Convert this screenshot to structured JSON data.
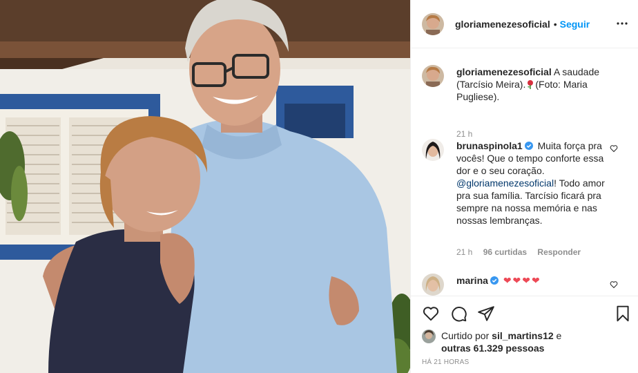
{
  "post": {
    "username": "gloriamenezesoficial",
    "follow_label": "Seguir",
    "separator": "•"
  },
  "caption": {
    "username": "gloriamenezesoficial",
    "text_1": "A saudade",
    "text_2": "(Tarcísio Meira).",
    "text_3": "(Foto: Maria",
    "text_4": "Pugliese).",
    "time": "21 h"
  },
  "comments": [
    {
      "username": "brunaspinola1",
      "verified": true,
      "line_1": "Muita força pra",
      "line_2": "vocês! Que o tempo conforte essa",
      "line_3": "dor e o seu coração.",
      "mention": "@gloriamenezesoficial",
      "line_4_rest": "! Todo",
      "line_5": "amor pra sua família. Tarcísio",
      "line_6": "ficará pra sempre na nossa",
      "line_7": "memória e nas nossas",
      "line_8": "lembranças.",
      "time": "21 h",
      "likes": "96 curtidas",
      "reply_label": "Responder"
    },
    {
      "username": "marina",
      "verified": true,
      "hearts": "❤❤❤❤"
    }
  ],
  "likes": {
    "prefix": "Curtido por",
    "user": "sil_martins12",
    "connector": "e",
    "others": "outras 61.329 pessoas"
  },
  "timestamp": "HÁ 21 HORAS",
  "colors": {
    "accent": "#0095f6",
    "text": "#262626",
    "muted": "#8e8e8e",
    "border": "#efefef",
    "mention": "#00376b",
    "heart_red": "#ed4956"
  },
  "icons": {
    "more": "more-horizontal-icon",
    "like": "heart-outline-icon",
    "comment": "comment-bubble-icon",
    "share": "paper-plane-icon",
    "save": "bookmark-icon",
    "verified": "verified-badge-icon",
    "rose": "rose-emoji-icon"
  }
}
